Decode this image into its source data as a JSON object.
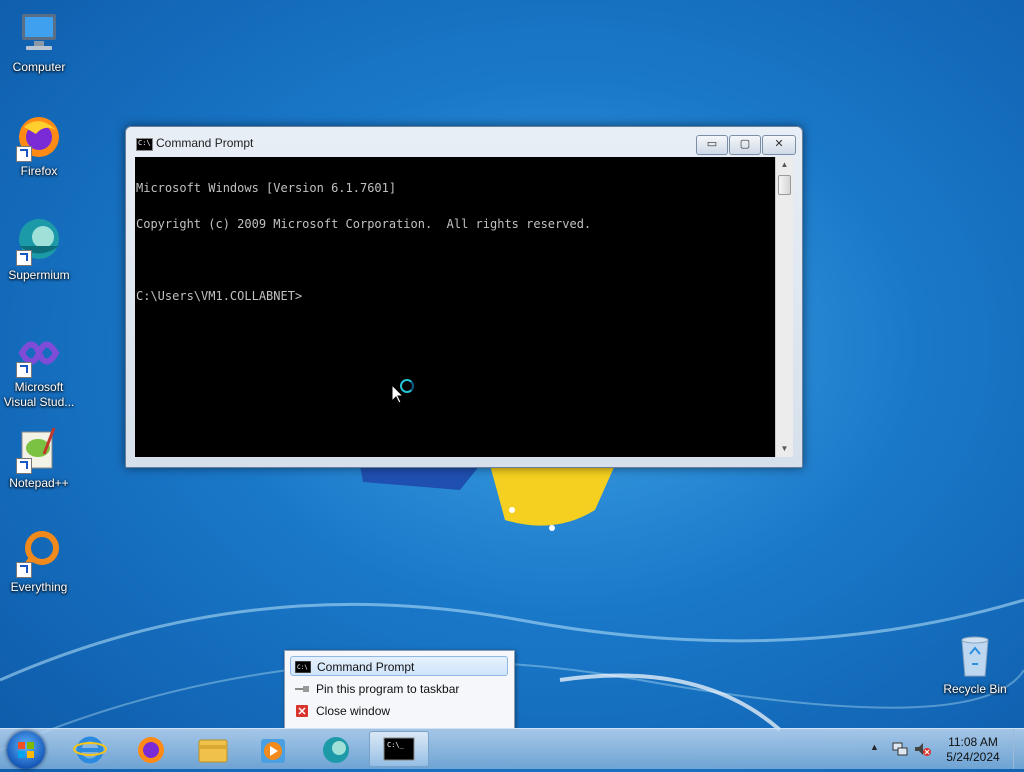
{
  "desktop": {
    "icons": [
      {
        "label": "Computer",
        "icon": "computer-icon"
      },
      {
        "label": "Firefox",
        "icon": "firefox-icon"
      },
      {
        "label": "Supermium",
        "icon": "supermium-icon"
      },
      {
        "label": "Microsoft Visual Stud...",
        "icon": "visual-studio-icon"
      },
      {
        "label": "Notepad++",
        "icon": "notepadpp-icon"
      },
      {
        "label": "Everything",
        "icon": "everything-icon"
      },
      {
        "label": "Recycle Bin",
        "icon": "recycle-bin-icon"
      }
    ]
  },
  "window": {
    "title": "Command Prompt",
    "buttons": {
      "minimize": "▭",
      "maximize": "▢",
      "close": "✕"
    },
    "console_lines": [
      "Microsoft Windows [Version 6.1.7601]",
      "Copyright (c) 2009 Microsoft Corporation.  All rights reserved.",
      "",
      "C:\\Users\\VM1.COLLABNET>"
    ]
  },
  "jumplist": {
    "items": [
      {
        "label": "Command Prompt",
        "icon": "cmd-icon"
      },
      {
        "label": "Pin this program to taskbar",
        "icon": "pin-icon"
      },
      {
        "label": "Close window",
        "icon": "close-window-icon"
      }
    ]
  },
  "taskbar": {
    "apps": [
      "internet-explorer-icon",
      "firefox-icon",
      "file-explorer-icon",
      "media-player-icon",
      "supermium-icon",
      "cmd-icon"
    ],
    "tray": {
      "time": "11:08 AM",
      "date": "5/24/2024"
    }
  },
  "colors": {
    "accent": "#1a78c9",
    "console_bg": "#000000",
    "console_fg": "#c0c0c0"
  }
}
